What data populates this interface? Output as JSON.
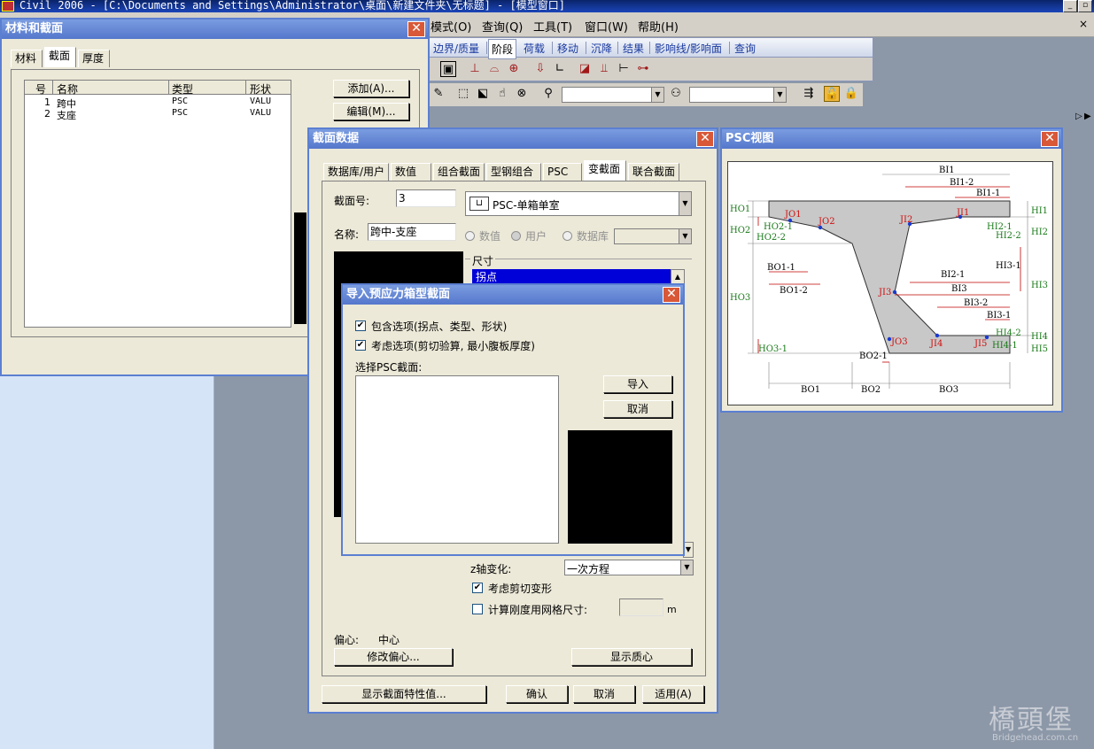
{
  "app": {
    "title": "Civil 2006 - [C:\\Documents and Settings\\Administrator\\桌面\\新建文件夹\\无标题] - [模型窗口]"
  },
  "menu": [
    "模式(O)",
    "查询(Q)",
    "工具(T)",
    "窗口(W)",
    "帮助(H)"
  ],
  "ribbon_tabs": [
    "边界/质量",
    "阶段",
    "荷载",
    "移动",
    "沉降",
    "结果",
    "影响线/影响面",
    "查询"
  ],
  "material_dialog": {
    "title": "材料和截面",
    "tabs": [
      "材料",
      "截面",
      "厚度"
    ],
    "columns": [
      "号",
      "名称",
      "类型",
      "形状"
    ],
    "rows": [
      {
        "no": "1",
        "name": "跨中",
        "type": "PSC",
        "shape": "VALU"
      },
      {
        "no": "2",
        "name": "支座",
        "type": "PSC",
        "shape": "VALU"
      }
    ],
    "add_button": "添加(A)...",
    "edit_button": "编辑(M)..."
  },
  "section_dialog": {
    "title": "截面数据",
    "tabs": [
      "数据库/用户",
      "数值",
      "组合截面",
      "型钢组合",
      "PSC",
      "变截面",
      "联合截面"
    ],
    "section_no_label": "截面号:",
    "section_no": "3",
    "section_type": "PSC-单箱单室",
    "name_label": "名称:",
    "name": "跨中-支座",
    "radio_numeric": "数值",
    "radio_user": "用户",
    "radio_db": "数据库",
    "dims_label": "尺寸",
    "list_selected": "拐点",
    "z_axis_label": "z轴变化:",
    "z_axis_value": "一次方程",
    "shear_label": "考虑剪切变形",
    "mesh_label": "计算刚度用网格尺寸:",
    "mesh_unit": "m",
    "offset_label": "偏心:",
    "offset_value": "中心",
    "modify_offset_btn": "修改偏心...",
    "show_centroid_btn": "显示质心",
    "show_props_btn": "显示截面特性值...",
    "ok_btn": "确认",
    "cancel_btn": "取消",
    "apply_btn": "适用(A)"
  },
  "import_dialog": {
    "title": "导入预应力箱型截面",
    "check1": "包含选项(拐点、类型、形状)",
    "check2": "考虑选项(剪切验算, 最小腹板厚度)",
    "select_label": "选择PSC截面:",
    "import_btn": "导入",
    "cancel_btn": "取消"
  },
  "psc_view": {
    "title": "PSC视图",
    "green_labels": [
      "HO1",
      "HO2",
      "HO2-1",
      "HO2-2",
      "HO3",
      "HO3-1",
      "HI1",
      "HI2",
      "HI2-1",
      "HI2-2",
      "HI3",
      "HI4",
      "HI4-1",
      "HI4-2",
      "HI5"
    ],
    "red_labels": [
      "JO1",
      "JO2",
      "JI2",
      "JI1",
      "JI3",
      "JO3",
      "JI4",
      "JI5"
    ],
    "black_labels": [
      "BI1",
      "BI1-2",
      "BI1-1",
      "BO1-1",
      "BO1-2",
      "BI2-1",
      "BI3",
      "BI3-2",
      "BI3-1",
      "HI3-1",
      "BO2-1",
      "BO1",
      "BO2",
      "BO3"
    ]
  },
  "watermark": {
    "logo_text": "橋頭堡",
    "url": "Bridgehead.com.cn"
  }
}
